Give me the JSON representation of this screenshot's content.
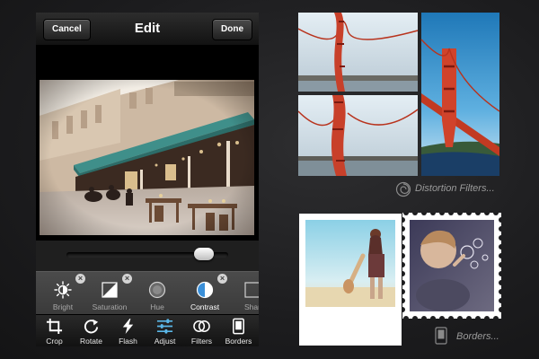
{
  "nav": {
    "cancel_label": "Cancel",
    "title": "Edit",
    "done_label": "Done"
  },
  "adjust": {
    "slider_value": 0.85
  },
  "filters": [
    {
      "label": "Bright",
      "icon": "sun-icon",
      "active": false
    },
    {
      "label": "Saturation",
      "icon": "saturation-icon",
      "active": false
    },
    {
      "label": "Hue",
      "icon": "hue-icon",
      "active": false
    },
    {
      "label": "Contrast",
      "icon": "contrast-icon",
      "active": true
    },
    {
      "label": "Shar",
      "icon": "sharpen-icon",
      "active": false
    }
  ],
  "toolbar": [
    {
      "label": "Crop",
      "icon": "crop-icon"
    },
    {
      "label": "Rotate",
      "icon": "rotate-icon"
    },
    {
      "label": "Flash",
      "icon": "flash-icon"
    },
    {
      "label": "Adjust",
      "icon": "adjust-sliders-icon"
    },
    {
      "label": "Filters",
      "icon": "filters-circles-icon"
    },
    {
      "label": "Borders",
      "icon": "borders-frame-icon"
    }
  ],
  "promo": {
    "distortion_label": "Distortion Filters...",
    "borders_label": "Borders..."
  },
  "colors": {
    "active_blue": "#3a8fd8",
    "accent_cyan": "#5ab7e8"
  }
}
